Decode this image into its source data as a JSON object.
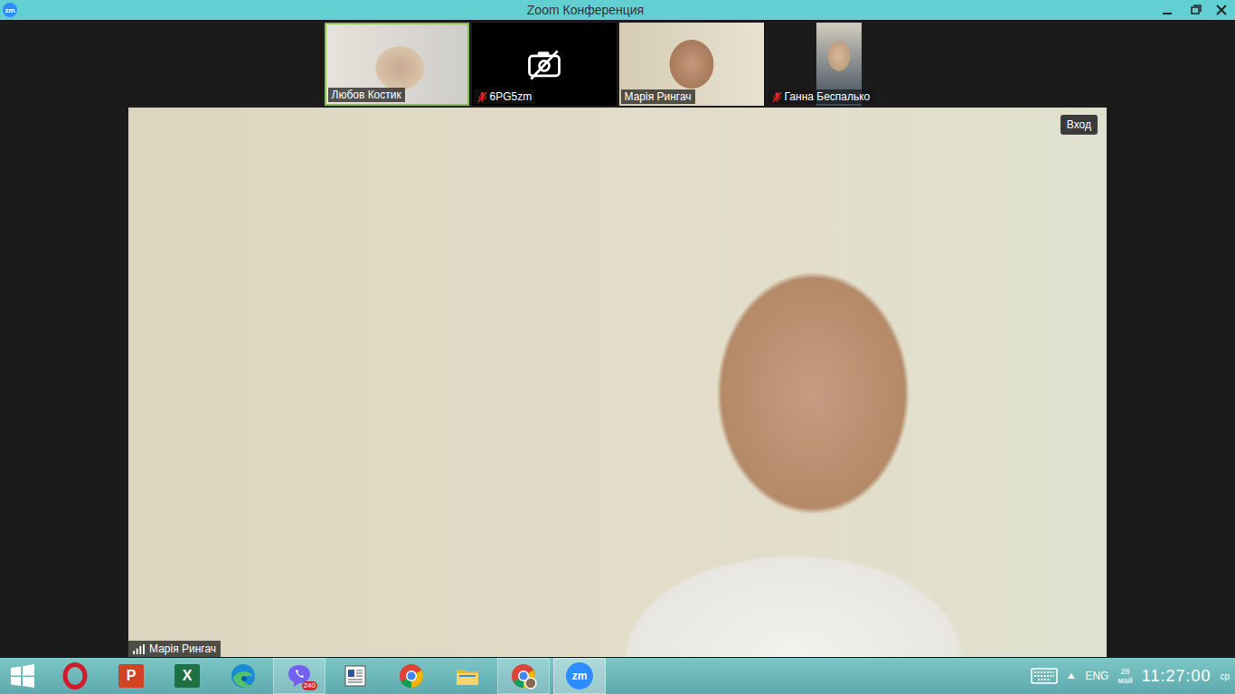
{
  "window": {
    "title": "Zoom Конференция",
    "logo": "zm"
  },
  "participants": [
    {
      "name": "Любов Костик",
      "kind": "video",
      "muted": false,
      "selected": true
    },
    {
      "name": "6PG5zm",
      "kind": "camera-off",
      "muted": true,
      "selected": false
    },
    {
      "name": "Марія Рингач",
      "kind": "video",
      "muted": false,
      "selected": false
    },
    {
      "name": "Ганна Беспалько",
      "kind": "portrait-video",
      "muted": true,
      "selected": false
    }
  ],
  "speaker": {
    "name": "Марія Рингач",
    "enter_button": "Вход"
  },
  "taskbar": {
    "apps": [
      {
        "kind": "start",
        "running": false,
        "active": false
      },
      {
        "kind": "opera",
        "running": false,
        "active": false
      },
      {
        "kind": "powerpoint",
        "glyph": "P",
        "running": false,
        "active": false
      },
      {
        "kind": "excel",
        "glyph": "X",
        "running": false,
        "active": false
      },
      {
        "kind": "edge",
        "running": false,
        "active": false
      },
      {
        "kind": "viber",
        "badge": "240",
        "running": true,
        "active": false
      },
      {
        "kind": "reader",
        "running": false,
        "active": false
      },
      {
        "kind": "chrome",
        "running": false,
        "active": false
      },
      {
        "kind": "explorer",
        "running": false,
        "active": false
      },
      {
        "kind": "chrome-profile",
        "running": true,
        "active": false
      },
      {
        "kind": "zoom",
        "glyph": "zm",
        "running": true,
        "active": true
      }
    ],
    "tray": {
      "language": "ENG",
      "date_day": "28",
      "date_month": "май",
      "time": "11:27:00",
      "weekday": "ср"
    }
  }
}
